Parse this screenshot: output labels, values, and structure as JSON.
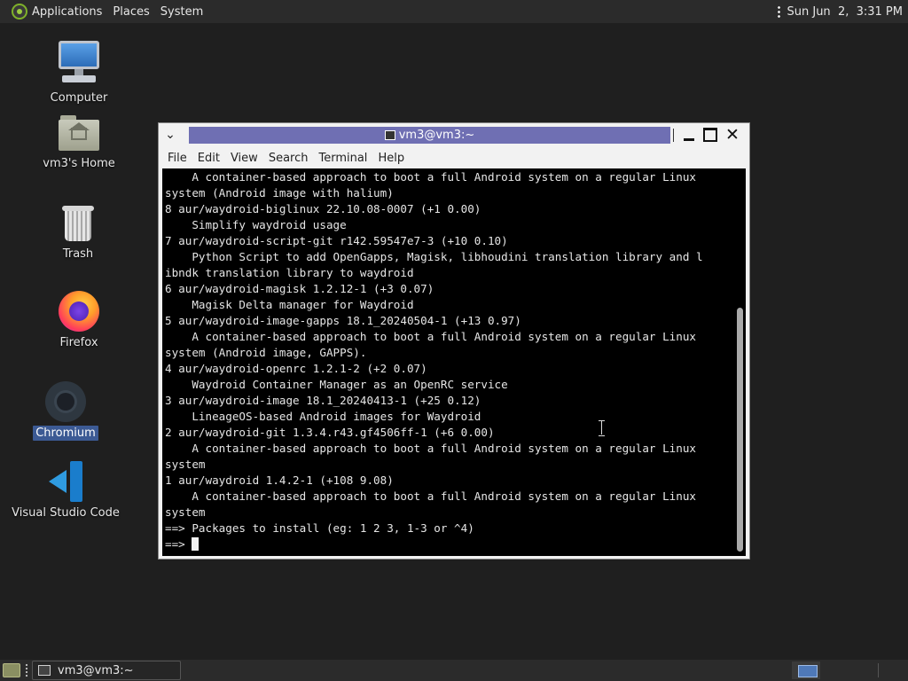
{
  "top_panel": {
    "menus": [
      "Applications",
      "Places",
      "System"
    ],
    "clock": "Sun Jun  2,  3:31 PM"
  },
  "desktop": {
    "icons": [
      {
        "label": "Computer",
        "icon": "computer-icon"
      },
      {
        "label": "vm3's Home",
        "icon": "home-folder-icon"
      },
      {
        "label": "Trash",
        "icon": "trash-icon"
      },
      {
        "label": "Firefox",
        "icon": "firefox-icon"
      },
      {
        "label": "Chromium",
        "icon": "chromium-icon",
        "selected": true
      },
      {
        "label": "Visual Studio Code",
        "icon": "vscode-icon"
      }
    ]
  },
  "window": {
    "title": "vm3@vm3:~",
    "menu": [
      "File",
      "Edit",
      "View",
      "Search",
      "Terminal",
      "Help"
    ]
  },
  "terminal": {
    "lines": [
      "    A container-based approach to boot a full Android system on a regular Linux",
      "system (Android image with halium)",
      "8 aur/waydroid-biglinux 22.10.08-0007 (+1 0.00)",
      "    Simplify waydroid usage",
      "7 aur/waydroid-script-git r142.59547e7-3 (+10 0.10)",
      "    Python Script to add OpenGapps, Magisk, libhoudini translation library and l",
      "ibndk translation library to waydroid",
      "6 aur/waydroid-magisk 1.2.12-1 (+3 0.07)",
      "    Magisk Delta manager for Waydroid",
      "5 aur/waydroid-image-gapps 18.1_20240504-1 (+13 0.97)",
      "    A container-based approach to boot a full Android system on a regular Linux",
      "system (Android image, GAPPS).",
      "4 aur/waydroid-openrc 1.2.1-2 (+2 0.07)",
      "    Waydroid Container Manager as an OpenRC service",
      "3 aur/waydroid-image 18.1_20240413-1 (+25 0.12)",
      "    LineageOS-based Android images for Waydroid",
      "2 aur/waydroid-git 1.3.4.r43.gf4506ff-1 (+6 0.00)",
      "    A container-based approach to boot a full Android system on a regular Linux",
      "system",
      "1 aur/waydroid 1.4.2-1 (+108 9.08)",
      "    A container-based approach to boot a full Android system on a regular Linux",
      "system",
      "==> Packages to install (eg: 1 2 3, 1-3 or ^4)"
    ],
    "prompt": "==> "
  },
  "bottom_panel": {
    "task_label": "vm3@vm3:~"
  }
}
